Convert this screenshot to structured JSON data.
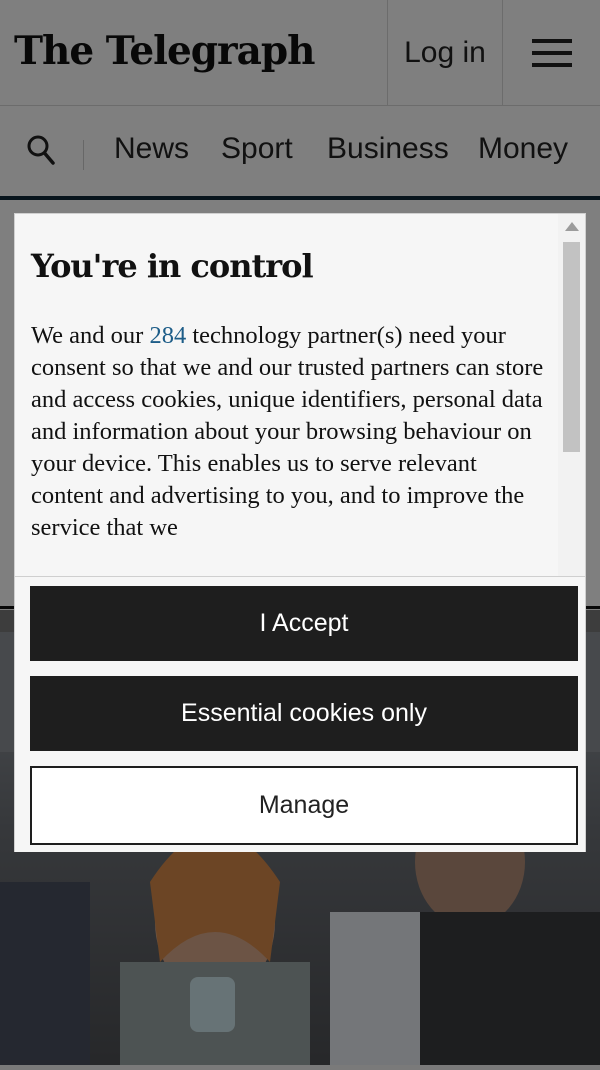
{
  "header": {
    "logo": "The Telegraph",
    "login_label": "Log in",
    "menu_icon": "hamburger-menu-icon"
  },
  "nav": {
    "search_icon": "search-icon",
    "items": [
      "News",
      "Sport",
      "Business",
      "Money"
    ]
  },
  "consent": {
    "title": "You're in control",
    "text_before": "We and our ",
    "partner_count": "284",
    "text_after": " technology partner(s) need your consent so that we and our trusted partners can store and access cookies, unique identifiers, personal data and information about your browsing behaviour on your device. This enables us to serve relevant content and advertising to you, and to improve the service that we",
    "buttons": {
      "accept": "I Accept",
      "essential": "Essential cookies only",
      "manage": "Manage"
    }
  },
  "colors": {
    "button_dark": "#1e1e1e",
    "link": "#1d5d88",
    "nav_rule": "#112a3b"
  }
}
